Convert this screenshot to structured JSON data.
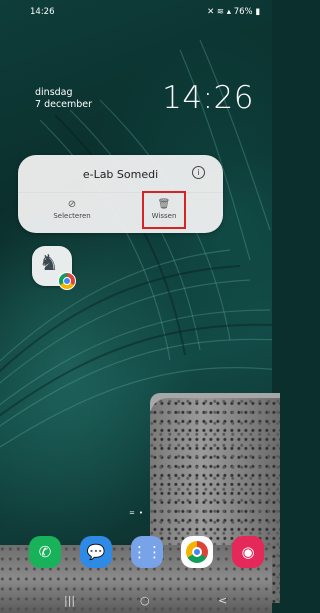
{
  "status_bar": {
    "time": "14:26",
    "icons": "mute-icon wifi-icon signal-icon",
    "battery": "76%"
  },
  "lock_widget": {
    "day": "dinsdag",
    "date": "7 december",
    "clock": "14:26"
  },
  "popup": {
    "title": "e-Lab Somedi",
    "info_icon": "i",
    "actions": [
      {
        "label": "Selecteren",
        "icon": "check-circle-icon",
        "glyph": "⊘"
      },
      {
        "label": "Wissen",
        "icon": "trash-icon",
        "glyph": "🗑"
      }
    ]
  },
  "app_icon": {
    "name": "chess-app-icon",
    "glyph": "♞"
  },
  "pager": "=•",
  "dock": [
    {
      "name": "phone-app",
      "glyph": "✆"
    },
    {
      "name": "messages-app",
      "glyph": "💬"
    },
    {
      "name": "apps-folder",
      "glyph": "⋮⋮"
    },
    {
      "name": "chrome-app",
      "glyph": ""
    },
    {
      "name": "camera-app",
      "glyph": "◉"
    }
  ],
  "nav_bar": {
    "recents": "|||",
    "home": "○",
    "back": "<"
  },
  "colors": {
    "highlight": "#d92222",
    "popup_bg": "#f2f2f2"
  }
}
